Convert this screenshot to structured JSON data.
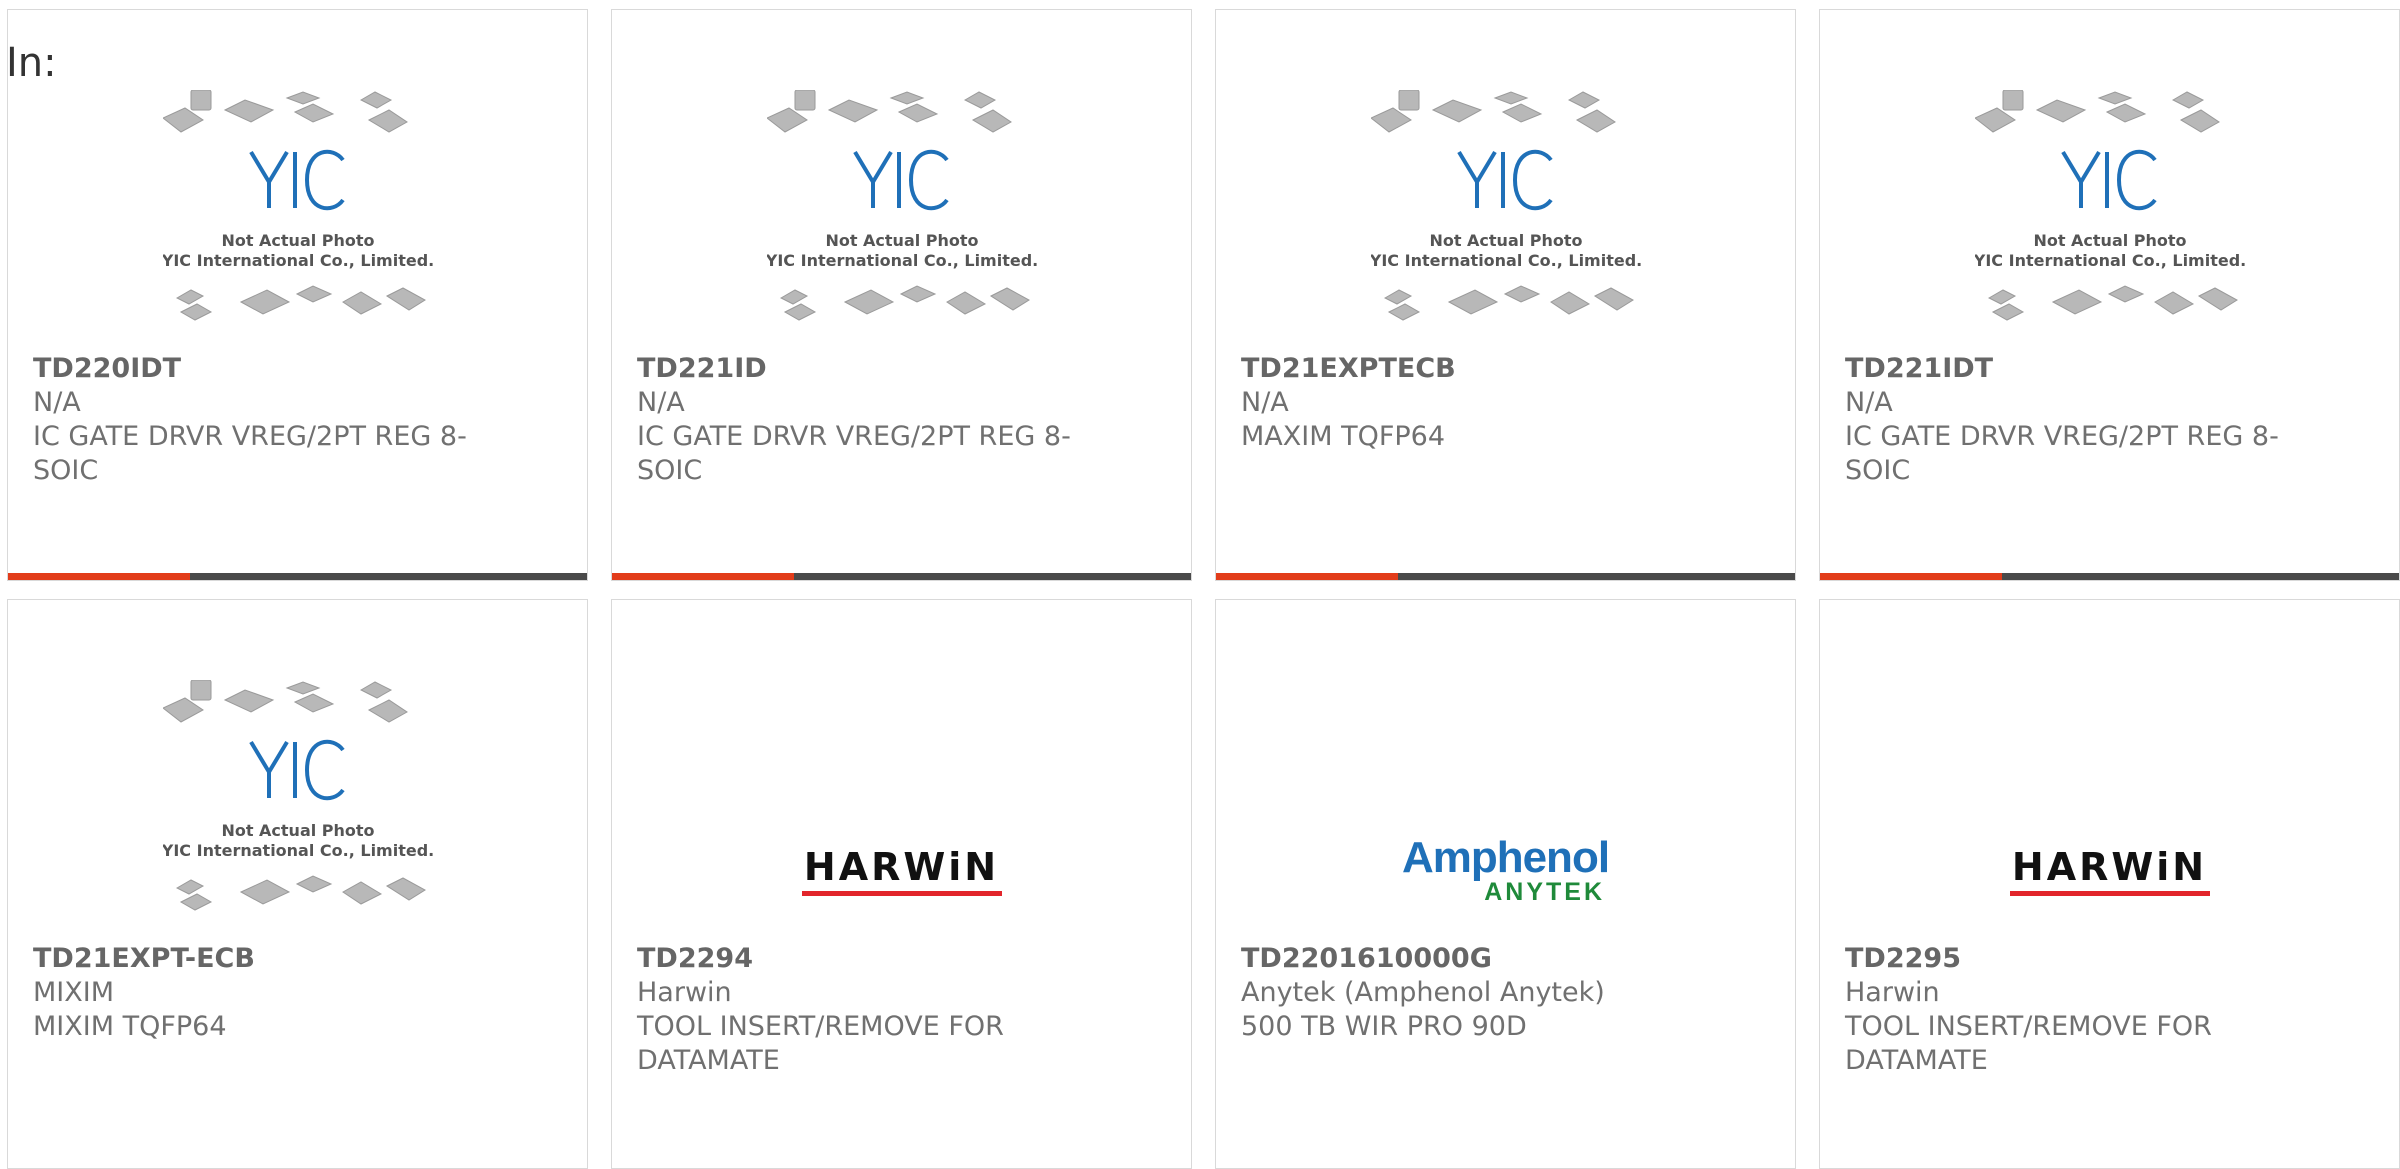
{
  "filter": {
    "prefix": "In:"
  },
  "placeholder_image": {
    "line1": "Not Actual Photo",
    "line2": "YIC International Co., Limited.",
    "logo_text": "YIC"
  },
  "brand_logos": {
    "harwin": "HARWiN",
    "amphenol_top": "Amphenol",
    "amphenol_bottom": "ANYTEK"
  },
  "colors": {
    "accent": "#e23c1a",
    "bar": "#4a4a4a",
    "yic_blue": "#1f70b8",
    "harwin_red": "#e2252b",
    "amphenol_green": "#1f8a3a"
  },
  "products": [
    {
      "part_number": "TD220IDT",
      "manufacturer": "N/A",
      "description": "IC GATE DRVR VREG/2PT REG 8-SOIC",
      "image": "placeholder"
    },
    {
      "part_number": "TD221ID",
      "manufacturer": "N/A",
      "description": "IC GATE DRVR VREG/2PT REG 8-SOIC",
      "image": "placeholder"
    },
    {
      "part_number": "TD21EXPTECB",
      "manufacturer": "N/A",
      "description": "MAXIM TQFP64",
      "image": "placeholder"
    },
    {
      "part_number": "TD221IDT",
      "manufacturer": "N/A",
      "description": "IC GATE DRVR VREG/2PT REG 8-SOIC",
      "image": "placeholder"
    },
    {
      "part_number": "TD21EXPT-ECB",
      "manufacturer": "MIXIM",
      "description": "MIXIM TQFP64",
      "image": "placeholder"
    },
    {
      "part_number": "TD2294",
      "manufacturer": "Harwin",
      "description": "TOOL INSERT/REMOVE FOR DATAMATE",
      "image": "harwin-logo"
    },
    {
      "part_number": "TD2201610000G",
      "manufacturer": "Anytek (Amphenol Anytek)",
      "description": "500 TB WIR PRO 90D",
      "image": "amphenol-anytek-logo"
    },
    {
      "part_number": "TD2295",
      "manufacturer": "Harwin",
      "description": "TOOL INSERT/REMOVE FOR DATAMATE",
      "image": "harwin-logo"
    }
  ]
}
